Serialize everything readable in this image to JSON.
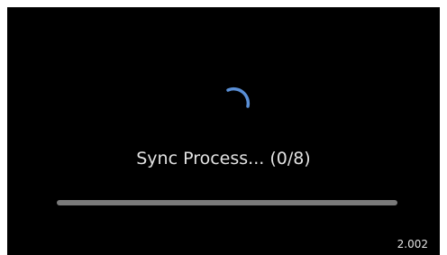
{
  "sync": {
    "status_text": "Sync Process... (0/8)",
    "completed": 0,
    "total": 8,
    "progress_fraction": 0.0
  },
  "spinner": {
    "icon": "loading-spinner-icon",
    "color": "#5a8fd6"
  },
  "footer": {
    "version": "2.002"
  },
  "colors": {
    "background": "#000000",
    "text": "#e3e3e3",
    "progress_track": "#7a7a7a"
  }
}
